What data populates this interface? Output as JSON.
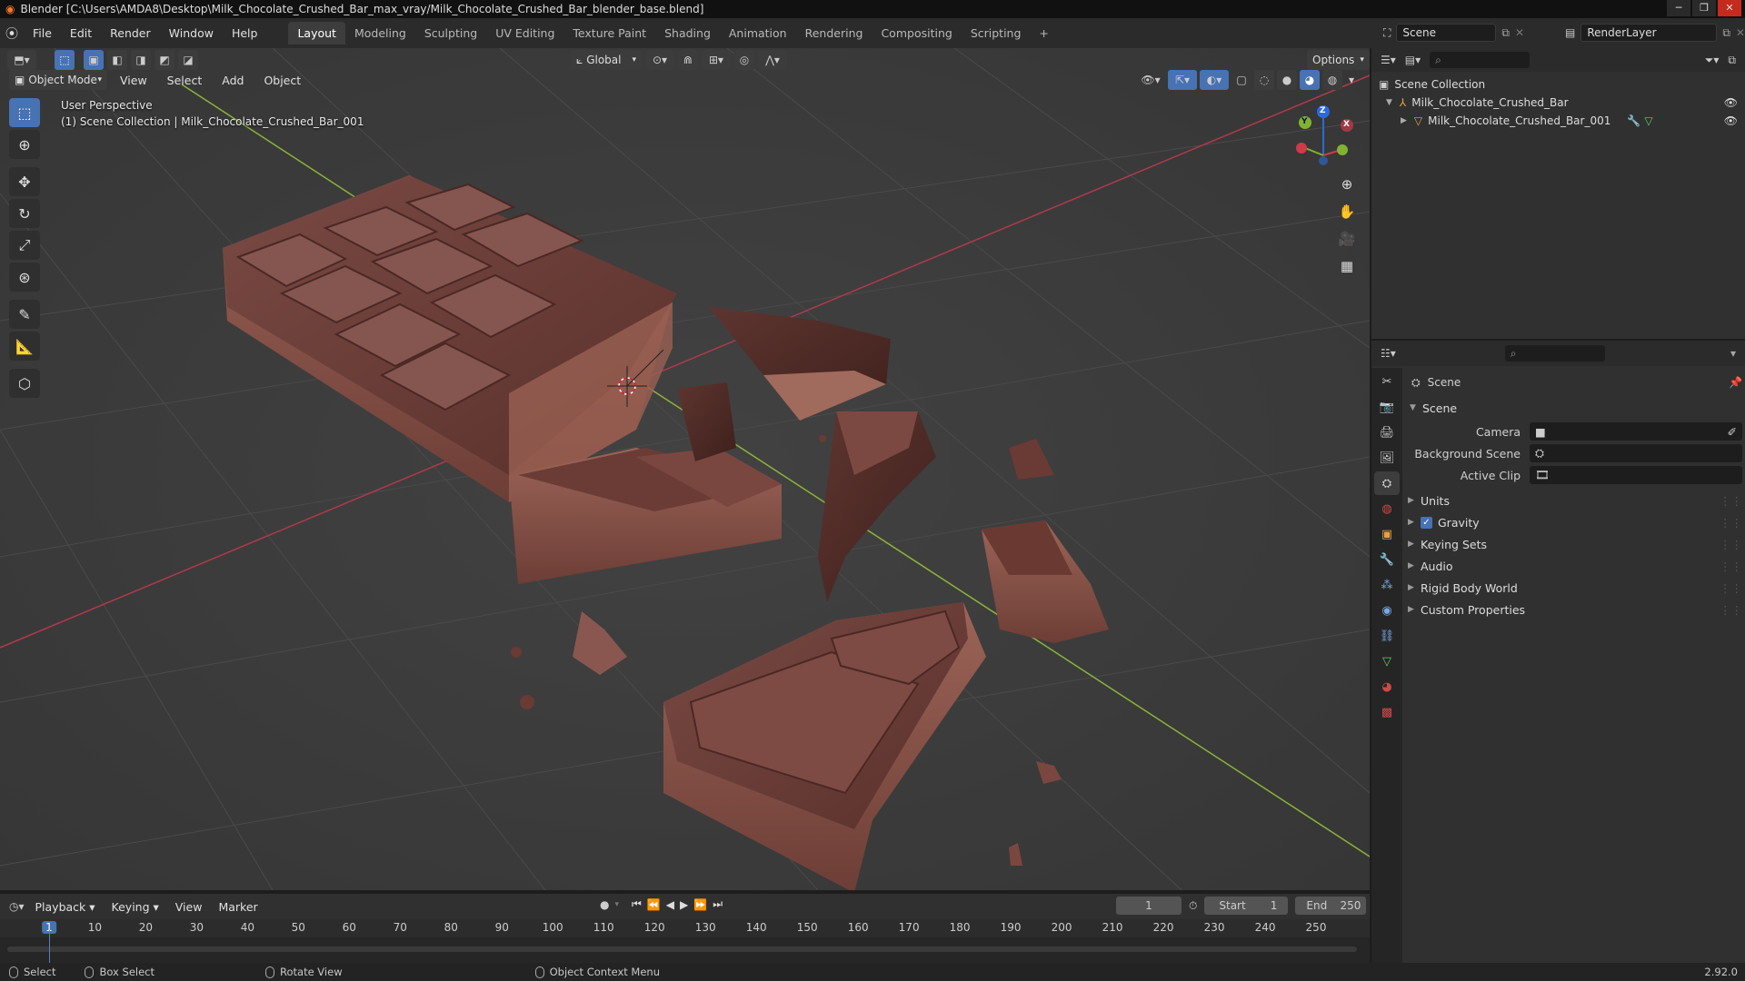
{
  "window": {
    "title": "Blender [C:\\Users\\AMDA8\\Desktop\\Milk_Chocolate_Crushed_Bar_max_vray/Milk_Chocolate_Crushed_Bar_blender_base.blend]"
  },
  "menu": {
    "items": [
      "File",
      "Edit",
      "Render",
      "Window",
      "Help"
    ]
  },
  "workspaces": {
    "tabs": [
      "Layout",
      "Modeling",
      "Sculpting",
      "UV Editing",
      "Texture Paint",
      "Shading",
      "Animation",
      "Rendering",
      "Compositing",
      "Scripting"
    ],
    "active": "Layout",
    "add_icon": "plus-icon"
  },
  "top_right": {
    "scene": "Scene",
    "render_layer": "RenderLayer"
  },
  "viewport_header": {
    "mode": "Object Mode",
    "menus": [
      "View",
      "Select",
      "Add",
      "Object"
    ],
    "orientation": "Global",
    "options": "Options"
  },
  "viewport": {
    "perspective": "User Perspective",
    "collection_info": "(1) Scene Collection | Milk_Chocolate_Crushed_Bar_001",
    "gizmo": {
      "z": "Z",
      "y": "Y",
      "x": "X"
    },
    "background": "#3d3d3d",
    "x_axis_color": "#b03a48",
    "y_axis_color": "#8bb536"
  },
  "toolbar": {
    "tools": [
      "select-box-icon",
      "cursor-icon",
      "move-icon",
      "rotate-icon",
      "scale-icon",
      "transform-icon",
      "annotate-icon",
      "measure-icon",
      "add-cube-icon"
    ],
    "active": "select-box-icon"
  },
  "outliner": {
    "root": "Scene Collection",
    "items": [
      {
        "name": "Milk_Chocolate_Crushed_Bar",
        "level": 1
      },
      {
        "name": "Milk_Chocolate_Crushed_Bar_001",
        "level": 2
      }
    ]
  },
  "properties": {
    "breadcrumb": "Scene",
    "section": "Scene",
    "fields": [
      {
        "label": "Camera",
        "value": ""
      },
      {
        "label": "Background Scene",
        "value": ""
      },
      {
        "label": "Active Clip",
        "value": ""
      }
    ],
    "panels": [
      "Units",
      "Gravity",
      "Keying Sets",
      "Audio",
      "Rigid Body World",
      "Custom Properties"
    ],
    "gravity_checked": true
  },
  "timeline": {
    "menus": [
      "Playback",
      "Keying",
      "View",
      "Marker"
    ],
    "current_frame": "1",
    "start_label": "Start",
    "start": "1",
    "end_label": "End",
    "end": "250",
    "ticks": [
      "1",
      "10",
      "20",
      "30",
      "40",
      "50",
      "60",
      "70",
      "80",
      "90",
      "100",
      "110",
      "120",
      "130",
      "140",
      "150",
      "160",
      "170",
      "180",
      "190",
      "200",
      "210",
      "220",
      "230",
      "240",
      "250"
    ]
  },
  "statusbar": {
    "items": [
      "Select",
      "Box Select",
      "Rotate View",
      "Object Context Menu"
    ],
    "version": "2.92.0"
  }
}
